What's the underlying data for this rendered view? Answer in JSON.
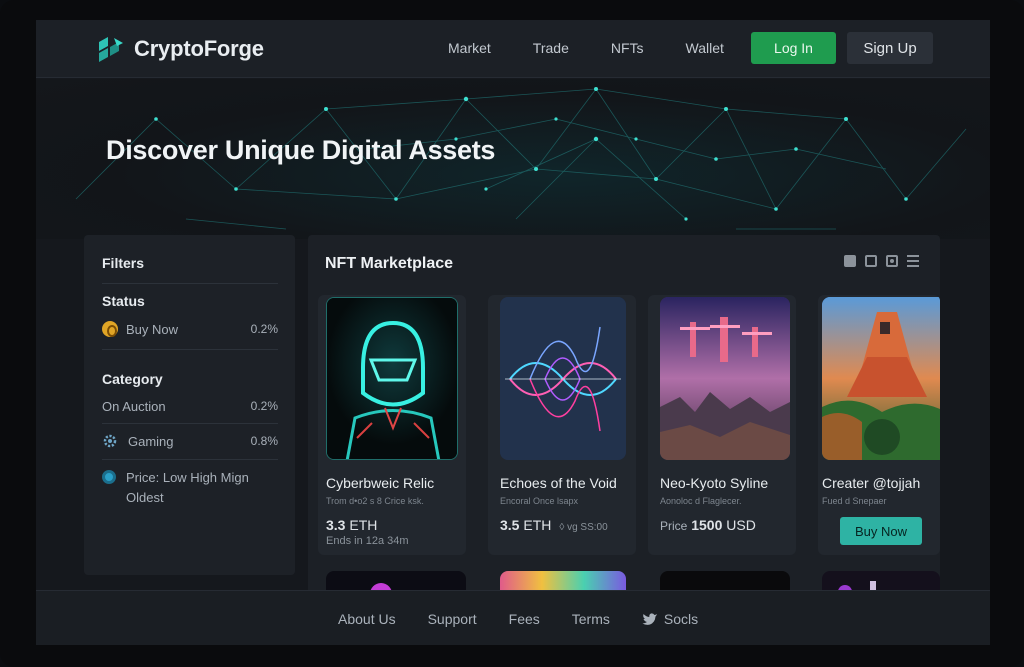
{
  "brand": {
    "name": "CryptoForge",
    "logo_icon": "cube-logo-icon",
    "accent": "#2ec4b6"
  },
  "nav": {
    "links": [
      "Market",
      "Trade",
      "NFTs",
      "Wallet"
    ],
    "login": "Log In",
    "signup": "Sign Up"
  },
  "hero": {
    "title": "Discover Unique Digital Assets"
  },
  "filters": {
    "title": "Filters",
    "status_heading": "Status",
    "status_items": [
      {
        "label": "Buy Now",
        "value": "0.2%",
        "icon": "coin-icon"
      }
    ],
    "category_heading": "Category",
    "category_items": [
      {
        "label": "On Auction",
        "value": "0.2%"
      },
      {
        "label": "Gaming",
        "value": "0.8%",
        "icon": "gear-icon"
      }
    ],
    "price_label": "Price: Low High Mign Oldest",
    "price_icon": "toggle-icon"
  },
  "market": {
    "title": "NFT Marketplace",
    "view_icons": [
      "grid-view-icon",
      "square-view-icon",
      "target-view-icon",
      "list-view-icon"
    ],
    "cards": [
      {
        "name": "Cyberbweic Relic",
        "sub": "Trom d•o2 s 8 Crice ksk.",
        "price": "3.3",
        "currency": "ETH",
        "ends": "Ends in 12a 34m"
      },
      {
        "name": "Echoes of the Void",
        "sub": "Encoral Once lsapx",
        "price": "3.5",
        "currency": "ETH",
        "extra": "◊ vg SS:00"
      },
      {
        "name": "Neo-Kyoto Syline",
        "sub": "Aonoloc d Flaglecer.",
        "price_label": "Price",
        "price": "1500",
        "currency": "USD"
      },
      {
        "name": "Creater @tojjah",
        "sub": "Fued d Snepaer",
        "button": "Buy Now"
      }
    ]
  },
  "footer": {
    "links": [
      "About Us",
      "Support",
      "Fees",
      "Terms",
      "Socls"
    ],
    "social_icon": "bird-icon"
  }
}
